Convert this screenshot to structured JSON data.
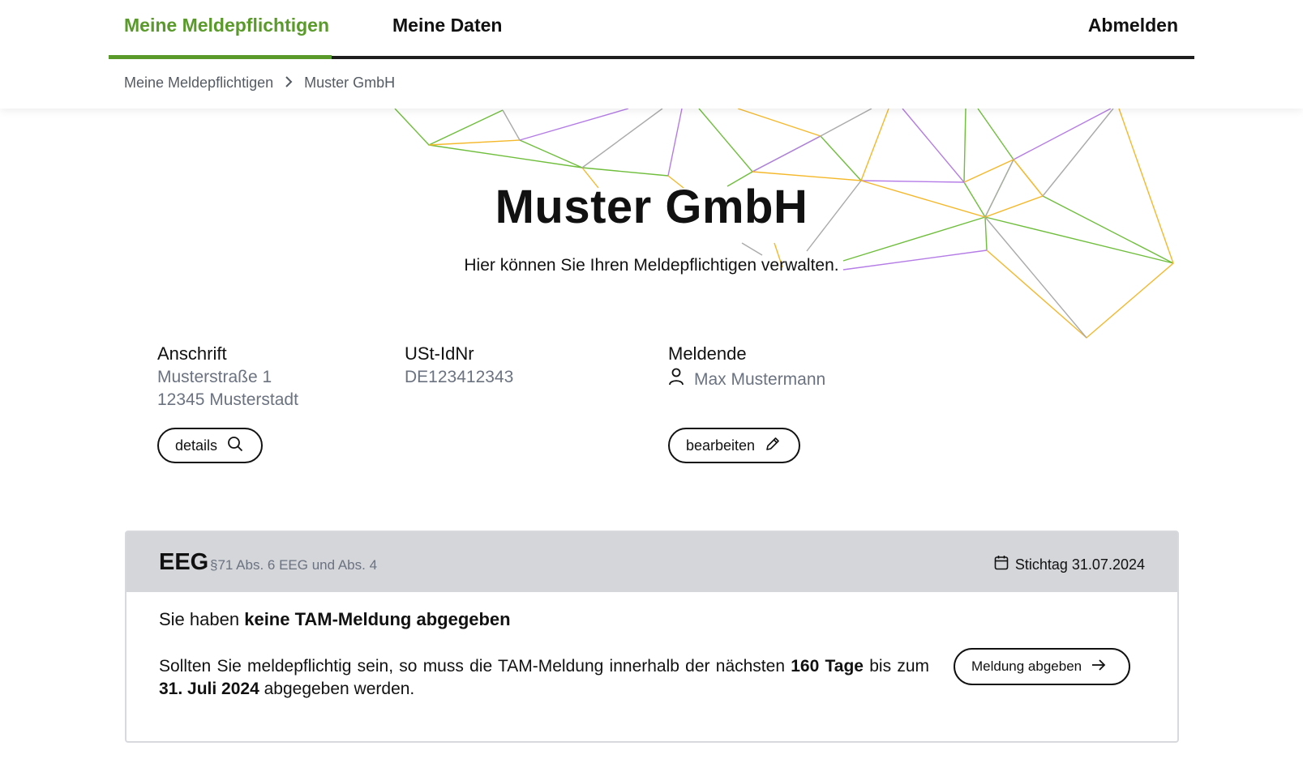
{
  "nav": {
    "tabs": [
      {
        "label": "Meine Meldepflichtigen",
        "active": true
      },
      {
        "label": "Meine Daten",
        "active": false
      }
    ],
    "logout_label": "Abmelden"
  },
  "breadcrumb": {
    "items": [
      "Meine Meldepflichtigen",
      "Muster GmbH"
    ]
  },
  "hero": {
    "title": "Muster GmbH",
    "subtitle": "Hier können Sie Ihren Meldepflichtigen verwalten."
  },
  "company": {
    "address_label": "Anschrift",
    "address_line1": "Musterstraße 1",
    "address_line2": "12345 Musterstadt",
    "vat_label": "USt-IdNr",
    "vat_value": "DE123412343",
    "reporter_label": "Meldende",
    "reporter_name": "Max Mustermann",
    "details_button": "details",
    "edit_button": "bearbeiten"
  },
  "card": {
    "title": "EEG",
    "law": "§71 Abs. 6 EEG und Abs. 4",
    "deadline": "Stichtag 31.07.2024",
    "status_prefix": "Sie haben",
    "status_bold": "keine TAM-Meldung abgegeben",
    "text_part1": "Sollten Sie meldepflichtig sein, so muss die TAM-Meldung innerhalb der nächsten",
    "text_days": "160 Tage",
    "text_part2": "bis zum",
    "text_date": "31. Juli 2024",
    "text_part3": "abgegeben werden.",
    "submit_button": "Meldung abgeben"
  },
  "colors": {
    "accent_green": "#5a9a2b",
    "line_green": "#6fbe3c",
    "line_purple": "#b47ce6",
    "line_orange": "#f4b82a",
    "line_gray": "#aaaaaa",
    "card_header": "#d4d6da"
  },
  "icons": {
    "breadcrumb_separator": "chevron-right-icon",
    "reporter": "user-icon",
    "details": "search-icon",
    "edit": "pencil-icon",
    "deadline": "calendar-icon",
    "submit": "arrow-right-icon"
  }
}
